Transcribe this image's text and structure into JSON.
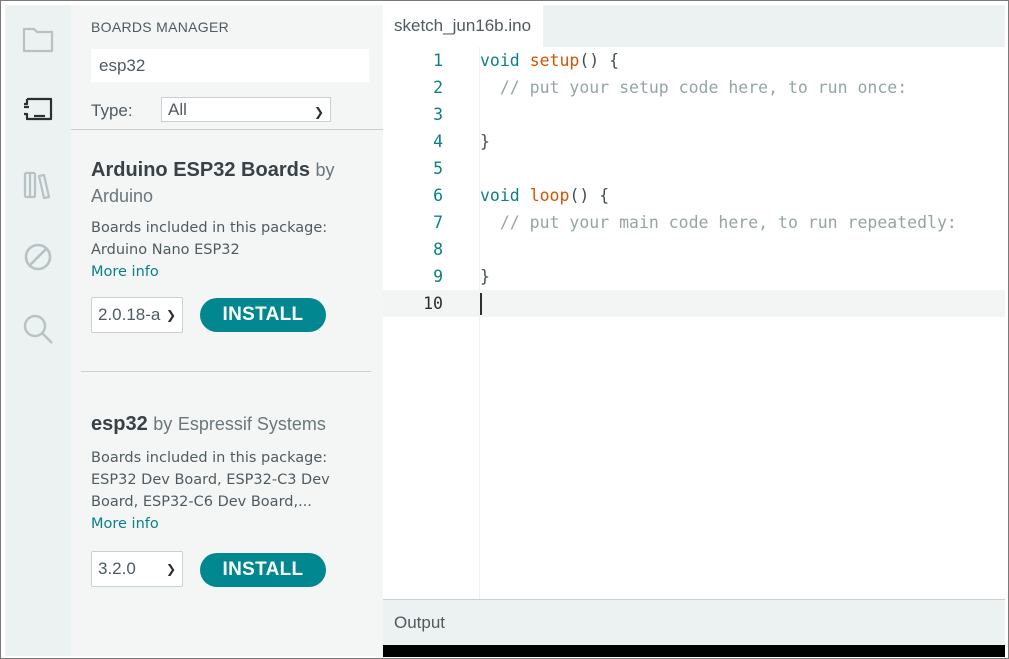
{
  "activity_bar": {
    "items": [
      {
        "icon": "folder-icon"
      },
      {
        "icon": "boards-manager-icon"
      },
      {
        "icon": "library-manager-icon"
      },
      {
        "icon": "debug-icon"
      },
      {
        "icon": "search-icon"
      }
    ]
  },
  "boards_manager": {
    "title": "BOARDS MANAGER",
    "search_value": "esp32",
    "type_label": "Type:",
    "type_value": "All",
    "packages": [
      {
        "name": "Arduino ESP32 Boards",
        "by": "by",
        "author": "Arduino",
        "desc_lines": [
          "Boards included in this package:",
          "Arduino Nano ESP32"
        ],
        "more_info": "More info",
        "version": "2.0.18-a",
        "install_label": "INSTALL"
      },
      {
        "name": "esp32",
        "by": "by",
        "author": "Espressif Systems",
        "desc_lines": [
          "Boards included in this package:",
          "ESP32 Dev Board, ESP32-C3 Dev",
          "Board, ESP32-C6 Dev Board,..."
        ],
        "more_info": "More info",
        "version": "3.2.0",
        "install_label": "INSTALL"
      }
    ]
  },
  "editor": {
    "tab_label": "sketch_jun16b.ino",
    "lines": [
      {
        "n": "1",
        "kw": "void",
        "fn": "setup",
        "rest": "() {",
        "cm": ""
      },
      {
        "n": "2",
        "kw": "",
        "fn": "",
        "rest": "",
        "cm": "  // put your setup code here, to run once:"
      },
      {
        "n": "3",
        "kw": "",
        "fn": "",
        "rest": "",
        "cm": ""
      },
      {
        "n": "4",
        "kw": "",
        "fn": "",
        "rest": "}",
        "cm": ""
      },
      {
        "n": "5",
        "kw": "",
        "fn": "",
        "rest": "",
        "cm": ""
      },
      {
        "n": "6",
        "kw": "void",
        "fn": "loop",
        "rest": "() {",
        "cm": ""
      },
      {
        "n": "7",
        "kw": "",
        "fn": "",
        "rest": "",
        "cm": "  // put your main code here, to run repeatedly:"
      },
      {
        "n": "8",
        "kw": "",
        "fn": "",
        "rest": "",
        "cm": ""
      },
      {
        "n": "9",
        "kw": "",
        "fn": "",
        "rest": "}",
        "cm": ""
      },
      {
        "n": "10",
        "kw": "",
        "fn": "",
        "rest": "",
        "cm": ""
      }
    ],
    "active_line": "10"
  },
  "output": {
    "label": "Output"
  },
  "colors": {
    "accent": "#00878f",
    "keyword": "#0b7f86",
    "function": "#d35400",
    "comment": "#95a5a6"
  }
}
